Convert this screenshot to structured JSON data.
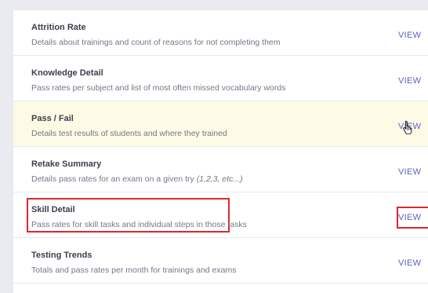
{
  "reports": [
    {
      "title": "Attrition Rate",
      "description": "Details about trainings and count of reasons for not completing them",
      "action": "VIEW"
    },
    {
      "title": "Knowledge Detail",
      "description": "Pass rates per subject and list of most often missed vocabulary words",
      "action": "VIEW"
    },
    {
      "title": "Pass / Fail",
      "description": "Details test results of students and where they trained",
      "action": "VIEW"
    },
    {
      "title": "Retake Summary",
      "description": "Details pass rates for an exam on a given try ",
      "description_italic": "(1,2,3, etc...)",
      "action": "VIEW"
    },
    {
      "title": "Skill Detail",
      "description": "Pass rates for skill tasks and individual steps in those tasks",
      "action": "VIEW"
    },
    {
      "title": "Testing Trends",
      "description": "Totals and pass rates per month for trainings and exams",
      "action": "VIEW"
    }
  ],
  "colors": {
    "link": "#5b61c8",
    "hover_row": "#fdfbe5",
    "highlight": "#e0262e"
  },
  "icons": {
    "cursor": "hand-pointer-cursor-icon"
  }
}
